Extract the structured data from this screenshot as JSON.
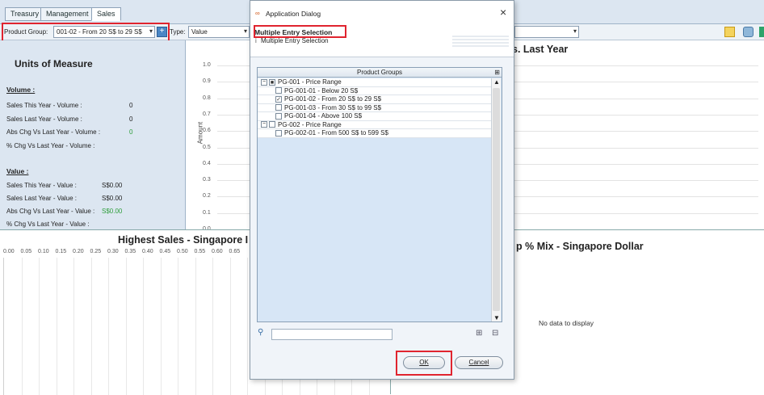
{
  "tabs": [
    "Treasury",
    "Management",
    "Sales"
  ],
  "toolbar": {
    "product_group_label": "Product Group:",
    "product_group_value": "001-02 - From 20 S$ to 29 S$",
    "type_label": "Type:",
    "type_value": "Value"
  },
  "uom": {
    "title": "Units of Measure",
    "volume_header": "Volume :",
    "value_header": "Value :",
    "rows_volume": [
      {
        "label": "Sales This Year - Volume :",
        "value": "0"
      },
      {
        "label": "Sales Last Year - Volume :",
        "value": "0"
      },
      {
        "label": "Abs Chg Vs Last Year - Volume :",
        "value": "0"
      },
      {
        "label": "% Chg Vs Last Year - Volume :",
        "value": ""
      }
    ],
    "rows_value": [
      {
        "label": "Sales This Year - Value :",
        "value": "S$0.00"
      },
      {
        "label": "Sales Last Year - Value :",
        "value": "S$0.00"
      },
      {
        "label": "Abs Chg Vs Last Year - Value :",
        "value": "S$0.00"
      },
      {
        "label": "% Chg Vs Last Year - Value :",
        "value": ""
      }
    ],
    "green_color": "#2f9e3c"
  },
  "top_chart": {
    "title_fragment": "s. Last Year",
    "y_axis_label": "Amount",
    "y_ticks": [
      "1.0",
      "0.9",
      "0.8",
      "0.7",
      "0.6",
      "0.5",
      "0.4",
      "0.3",
      "0.2",
      "0.1",
      "0.0"
    ]
  },
  "bottom_left_chart": {
    "title": "Highest Sales - Singapore I",
    "x_ticks": [
      "0.00",
      "0.05",
      "0.10",
      "0.15",
      "0.20",
      "0.25",
      "0.30",
      "0.35",
      "0.40",
      "0.45",
      "0.50",
      "0.55",
      "0.60",
      "0.65"
    ]
  },
  "bottom_right_chart": {
    "title_fragment": "p % Mix - Singapore Dollar",
    "no_data": "No data to display"
  },
  "dialog": {
    "title": "Application Dialog",
    "close": "×",
    "header_title": "Multiple Entry Selection",
    "header_sub": "Multiple Entry Selection",
    "column_header": "Product Groups",
    "items": [
      {
        "text": "PG-001 - Price Range",
        "level": 0,
        "checked": "partial"
      },
      {
        "text": "PG-001-01 - Below 20 S$",
        "level": 1,
        "checked": "no"
      },
      {
        "text": "PG-001-02 - From 20 S$ to 29 S$",
        "level": 1,
        "checked": "yes"
      },
      {
        "text": "PG-001-03 - From 30 S$ to 99 S$",
        "level": 1,
        "checked": "no"
      },
      {
        "text": "PG-001-04 - Above 100 S$",
        "level": 1,
        "checked": "no"
      },
      {
        "text": "PG-002 - Price Range",
        "level": 0,
        "checked": "no"
      },
      {
        "text": "PG-002-01 - From 500 S$ to 599 S$",
        "level": 1,
        "checked": "no"
      }
    ],
    "ok_label": "OK",
    "cancel_label": "Cancel",
    "highlight_color": "#e0242f"
  }
}
